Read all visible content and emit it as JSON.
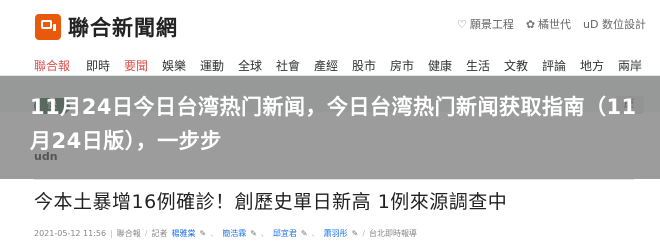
{
  "site": {
    "name": "聯合新聞網"
  },
  "top_links": [
    {
      "icon": "heart-icon",
      "glyph": "♡",
      "label": "願景工程"
    },
    {
      "icon": "flower-icon",
      "glyph": "✿",
      "label": "橘世代"
    },
    {
      "icon": "ud-icon",
      "glyph": "",
      "label": "uD 数位設計"
    }
  ],
  "nav": [
    {
      "label": "聯合報",
      "state": "brand"
    },
    {
      "label": "即時",
      "state": ""
    },
    {
      "label": "要聞",
      "state": "active"
    },
    {
      "label": "娛樂",
      "state": ""
    },
    {
      "label": "運動",
      "state": ""
    },
    {
      "label": "全球",
      "state": ""
    },
    {
      "label": "社會",
      "state": ""
    },
    {
      "label": "產經",
      "state": ""
    },
    {
      "label": "股市",
      "state": ""
    },
    {
      "label": "房市",
      "state": ""
    },
    {
      "label": "健康",
      "state": ""
    },
    {
      "label": "生活",
      "state": ""
    },
    {
      "label": "文教",
      "state": ""
    },
    {
      "label": "評論",
      "state": ""
    },
    {
      "label": "地方",
      "state": ""
    },
    {
      "label": "兩岸",
      "state": ""
    }
  ],
  "sub_bar": {
    "live_label": "快",
    "side_label": "歷",
    "brand_mark": "udn"
  },
  "overlay": {
    "title": "11月24日今日台湾热门新闻，今日台湾热门新闻获取指南（11月24日版），一步步"
  },
  "article": {
    "headline": "今本土暴增16例確診！創歷史單日新高 1例來源調查中",
    "date": "2021-05-12 11:56",
    "source": "聯合報",
    "authors_label": "記者",
    "authors": [
      "楊雅棠",
      "簡浩霖",
      "邱宜君",
      "蕭羽彤"
    ],
    "section": "台北即時報導"
  },
  "colors": {
    "accent": "#d9534f",
    "logo": "#e8590c",
    "overlay": "#5f5f5f"
  }
}
